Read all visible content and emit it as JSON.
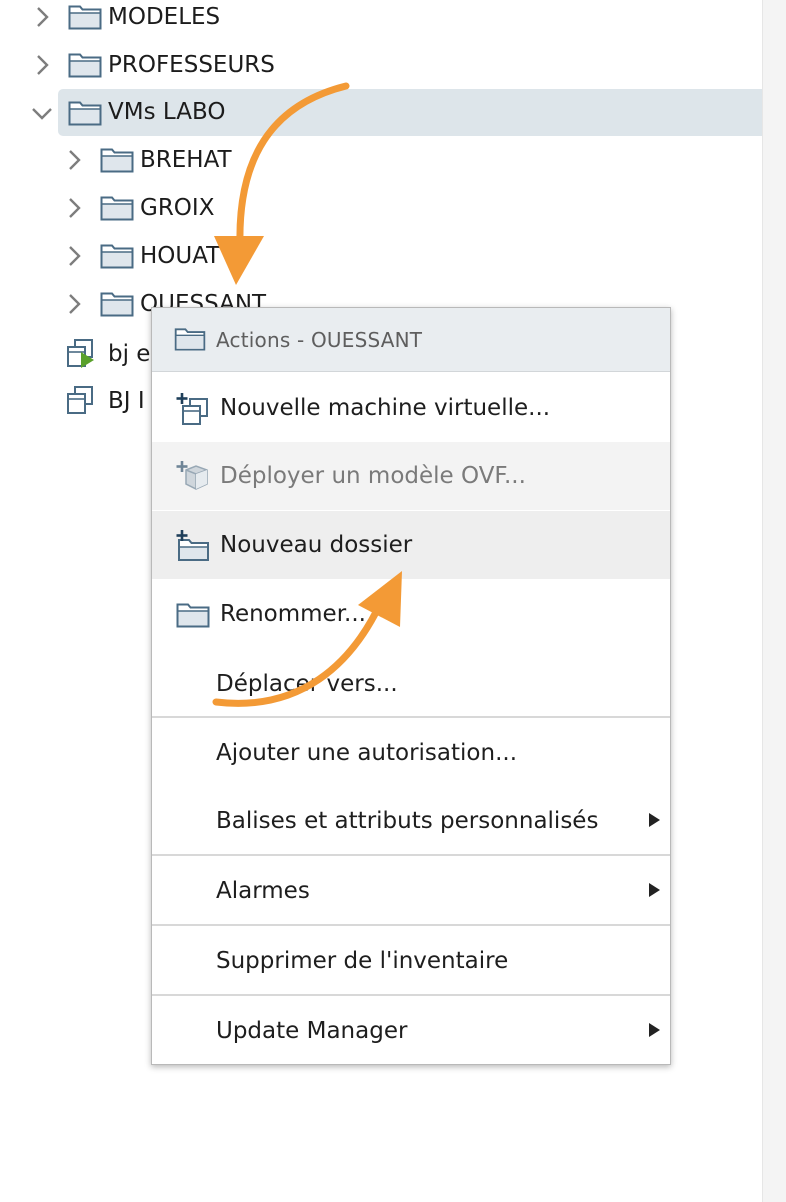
{
  "tree": {
    "items": [
      {
        "label": "MODELES"
      },
      {
        "label": "PROFESSEURS"
      },
      {
        "label": "VMs LABO"
      },
      {
        "label": "BREHAT"
      },
      {
        "label": "GROIX"
      },
      {
        "label": "HOUAT"
      },
      {
        "label": "OUESSANT"
      },
      {
        "label": "bj e"
      },
      {
        "label": "BJ I"
      }
    ]
  },
  "context_menu": {
    "header": "Actions - OUESSANT",
    "items": [
      {
        "label": "Nouvelle machine virtuelle..."
      },
      {
        "label": "Déployer un modèle OVF..."
      },
      {
        "label": "Nouveau dossier"
      },
      {
        "label": "Renommer..."
      },
      {
        "label": "Déplacer vers..."
      },
      {
        "label": "Ajouter une autorisation..."
      },
      {
        "label": "Balises et attributs personnalisés"
      },
      {
        "label": "Alarmes"
      },
      {
        "label": "Supprimer de l'inventaire"
      },
      {
        "label": "Update Manager"
      }
    ]
  },
  "colors": {
    "selection": "#dde5ea",
    "annotation_arrow": "#f39a36",
    "vm_play": "#5aa12c"
  },
  "icons": {
    "chevron": "chevron-right-icon",
    "expanded": "chevron-down-icon",
    "folder": "folder-icon",
    "vm": "vm-icon",
    "new_vm": "new-vm-icon",
    "ovf": "ovf-template-icon",
    "new_folder": "new-folder-icon",
    "submenu": "submenu-arrow-icon"
  }
}
